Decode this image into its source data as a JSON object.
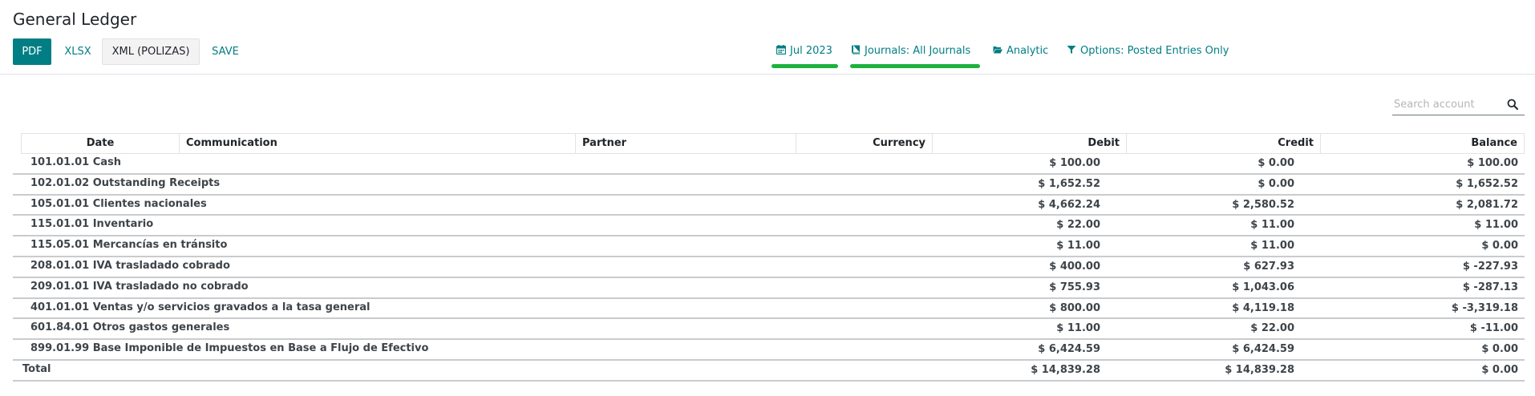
{
  "page": {
    "title": "General Ledger"
  },
  "toolbar": {
    "pdf": "PDF",
    "xlsx": "XLSX",
    "xml": "XML (POLIZAS)",
    "save": "SAVE"
  },
  "filters": {
    "date": "Jul 2023",
    "journals": "Journals: All Journals",
    "analytic": "Analytic",
    "options": "Options: Posted Entries Only"
  },
  "search": {
    "placeholder": "Search account"
  },
  "table": {
    "headers": {
      "date": "Date",
      "communication": "Communication",
      "partner": "Partner",
      "currency": "Currency",
      "debit": "Debit",
      "credit": "Credit",
      "balance": "Balance"
    },
    "rows": [
      {
        "name": "101.01.01 Cash",
        "debit": "$ 100.00",
        "credit": "$ 0.00",
        "balance": "$ 100.00"
      },
      {
        "name": "102.01.02 Outstanding Receipts",
        "debit": "$ 1,652.52",
        "credit": "$ 0.00",
        "balance": "$ 1,652.52"
      },
      {
        "name": "105.01.01 Clientes nacionales",
        "debit": "$ 4,662.24",
        "credit": "$ 2,580.52",
        "balance": "$ 2,081.72"
      },
      {
        "name": "115.01.01 Inventario",
        "debit": "$ 22.00",
        "credit": "$ 11.00",
        "balance": "$ 11.00"
      },
      {
        "name": "115.05.01 Mercancías en tránsito",
        "debit": "$ 11.00",
        "credit": "$ 11.00",
        "balance": "$ 0.00"
      },
      {
        "name": "208.01.01 IVA trasladado cobrado",
        "debit": "$ 400.00",
        "credit": "$ 627.93",
        "balance": "$ -227.93"
      },
      {
        "name": "209.01.01 IVA trasladado no cobrado",
        "debit": "$ 755.93",
        "credit": "$ 1,043.06",
        "balance": "$ -287.13"
      },
      {
        "name": "401.01.01 Ventas y/o servicios gravados a la tasa general",
        "debit": "$ 800.00",
        "credit": "$ 4,119.18",
        "balance": "$ -3,319.18"
      },
      {
        "name": "601.84.01 Otros gastos generales",
        "debit": "$ 11.00",
        "credit": "$ 22.00",
        "balance": "$ -11.00"
      },
      {
        "name": "899.01.99 Base Imponible de Impuestos en Base a Flujo de Efectivo",
        "debit": "$ 6,424.59",
        "credit": "$ 6,424.59",
        "balance": "$ 0.00"
      }
    ],
    "total": {
      "label": "Total",
      "debit": "$ 14,839.28",
      "credit": "$ 14,839.28",
      "balance": "$ 0.00"
    }
  },
  "colors": {
    "primary": "#017e84",
    "highlight": "#1bb23d"
  },
  "icons": {
    "date": "calendar-icon",
    "journals": "book-icon",
    "analytic": "folder-open-icon",
    "options": "filter-icon",
    "search": "search-icon"
  }
}
